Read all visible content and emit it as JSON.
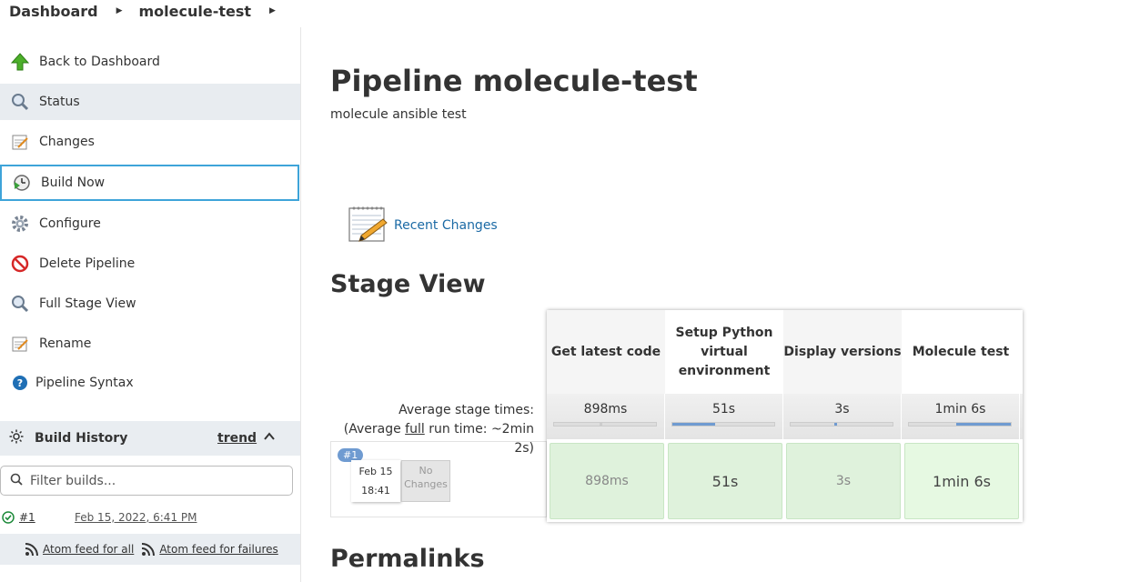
{
  "breadcrumb": {
    "dashboard": "Dashboard",
    "job": "molecule-test"
  },
  "sidebar": {
    "items": [
      {
        "label": "Back to Dashboard"
      },
      {
        "label": "Status"
      },
      {
        "label": "Changes"
      },
      {
        "label": "Build Now"
      },
      {
        "label": "Configure"
      },
      {
        "label": "Delete Pipeline"
      },
      {
        "label": "Full Stage View"
      },
      {
        "label": "Rename"
      },
      {
        "label": "Pipeline Syntax"
      }
    ]
  },
  "build_history": {
    "title": "Build History",
    "trend": "trend",
    "filter_placeholder": "Filter builds...",
    "builds": [
      {
        "number": "#1",
        "date": "Feb 15, 2022, 6:41 PM",
        "status": "success"
      }
    ],
    "feed_all": "Atom feed for all",
    "feed_failures": "Atom feed for failures"
  },
  "main": {
    "title": "Pipeline molecule-test",
    "description": "molecule ansible test",
    "recent_changes": "Recent Changes",
    "stage_view_title": "Stage View",
    "permalinks_title": "Permalinks"
  },
  "stage_view": {
    "avg_label_1": "Average stage times:",
    "avg_label_2a": "(Average ",
    "avg_label_full": "full",
    "avg_label_2b": " run time: ~2min",
    "avg_label_3": "2s)",
    "stages": [
      {
        "name": "Get latest code",
        "avg": "898ms",
        "avg_fraction": 0.0,
        "duration": "898ms"
      },
      {
        "name": "Setup Python virtual environment",
        "avg": "51s",
        "avg_fraction": 0.42,
        "duration": "51s"
      },
      {
        "name": "Display versions",
        "avg": "3s",
        "avg_fraction": 0.02,
        "duration": "3s"
      },
      {
        "name": "Molecule test",
        "avg": "1min 6s",
        "avg_fraction": 0.54,
        "duration": "1min 6s"
      }
    ],
    "run": {
      "badge": "#1",
      "date": "Feb 15",
      "time": "18:41",
      "no_changes_1": "No",
      "no_changes_2": "Changes"
    }
  },
  "colors": {
    "accent_link": "#1b6aa5",
    "focus_border": "#3ea4d9",
    "stage_success": "#dff2dc",
    "bar_fill": "#6f9bd1"
  }
}
